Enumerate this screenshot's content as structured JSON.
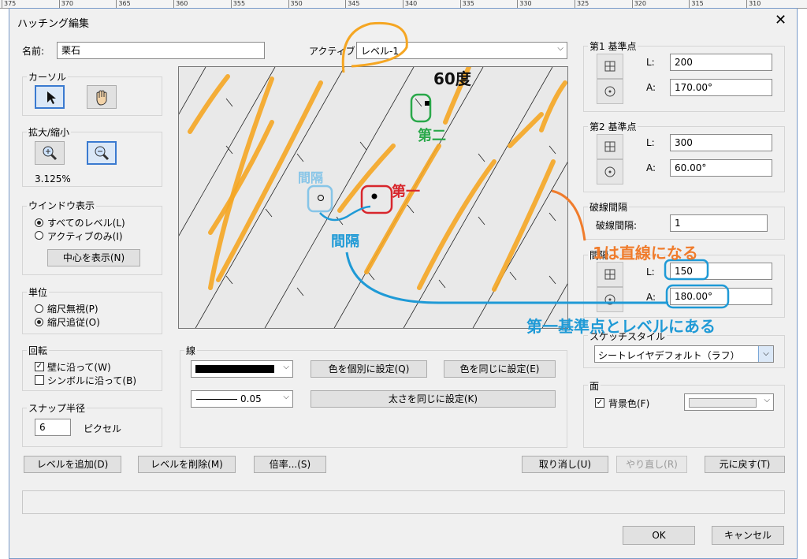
{
  "ruler": {
    "ticks": [
      "375",
      "370",
      "365",
      "360",
      "355",
      "350",
      "345",
      "340",
      "335",
      "330",
      "325",
      "320",
      "315",
      "310"
    ]
  },
  "dialog": {
    "title": "ハッチング編集",
    "close_glyph": "✕",
    "name_label": "名前:",
    "name_value": "栗石",
    "active_label": "アクティブ:",
    "active_value": "レベル-1",
    "cursor": {
      "label": "カーソル"
    },
    "zoom": {
      "label": "拡大/縮小",
      "value": "3.125%"
    },
    "window_display": {
      "label": "ウインドウ表示",
      "opt_all": "すべてのレベル(L)",
      "opt_active": "アクティブのみ(I)",
      "center_button": "中心を表示(N)"
    },
    "units": {
      "label": "単位",
      "opt_ignore": "縮尺無視(P)",
      "opt_follow": "縮尺追従(O)"
    },
    "rotation": {
      "label": "回転",
      "along_wall": "壁に沿って(W)",
      "along_symbol": "シンボルに沿って(B)"
    },
    "snap": {
      "label": "スナップ半径",
      "value": "6",
      "unit": "ピクセル"
    },
    "line": {
      "label": "線",
      "weight": "0.05",
      "color_individual": "色を個別に設定(Q)",
      "color_same": "色を同じに設定(E)",
      "weight_same": "太さを同じに設定(K)"
    },
    "ref1": {
      "label": "第1 基準点",
      "L_label": "L:",
      "L": "200",
      "A_label": "A:",
      "A": "170.00°"
    },
    "ref2": {
      "label": "第2 基準点",
      "L_label": "L:",
      "L": "300",
      "A_label": "A:",
      "A": "60.00°"
    },
    "dash": {
      "label": "破線間隔",
      "field_label": "破線間隔:",
      "value": "1"
    },
    "spacing": {
      "label": "間隔",
      "L_label": "L:",
      "L": "150",
      "A_label": "A:",
      "A": "180.00°"
    },
    "sketch": {
      "label": "スケッチスタイル",
      "value": "シートレイヤデフォルト（ラフ）"
    },
    "face": {
      "label": "面",
      "bg_label": "背景色(F)"
    },
    "buttons": {
      "add_level": "レベルを追加(D)",
      "delete_level": "レベルを削除(M)",
      "scale": "倍率...(S)",
      "undo": "取り消し(U)",
      "redo": "やり直し(R)",
      "revert": "元に戻す(T)",
      "ok": "OK",
      "cancel": "キャンセル"
    }
  },
  "annotations": {
    "angle": "60度",
    "second": "第二",
    "first": "第一",
    "spacing_small": "間隔",
    "spacing_big": "間隔",
    "line_note": "1は直線になる",
    "level_note": "第一基準点とレベルにある"
  },
  "colors": {
    "orange": "#f5a623",
    "green": "#2aa84a",
    "red": "#d8262c",
    "lightblue": "#86c5e8",
    "blue": "#1f9ad6",
    "ann_orange": "#f07c2c"
  }
}
